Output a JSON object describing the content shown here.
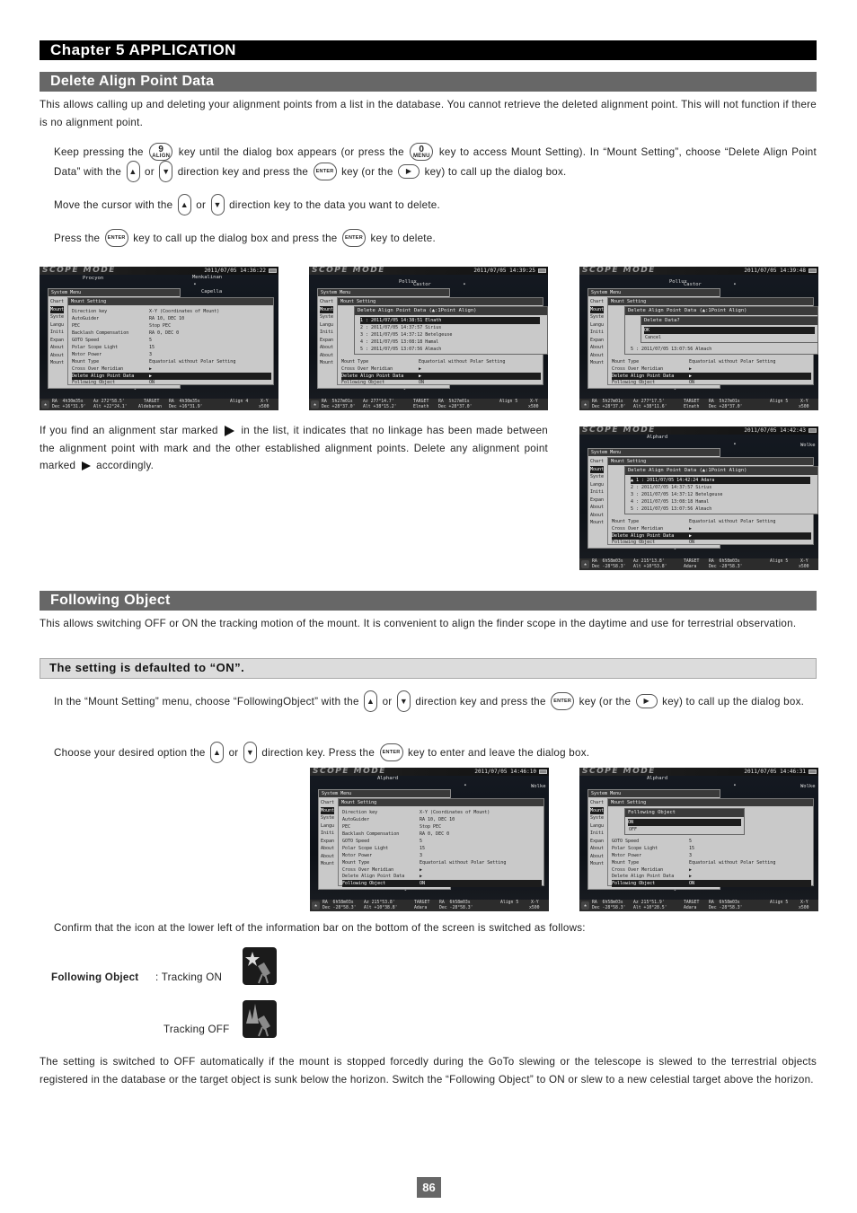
{
  "chapter": "Chapter 5  APPLICATION",
  "sections": {
    "delete_align": {
      "title": "Delete Align Point Data",
      "intro": "This allows calling up and deleting your alignment points from a list in the database.  You cannot retrieve the deleted alignment point. This will not function if there is no alignment point.",
      "step1": {
        "t1": "Keep pressing the",
        "t2": "key until the dialog box appears (or press the",
        "t3": "key to access Mount Setting).  In “Mount Setting”, choose “Delete Align Point Data” with the",
        "t4": "or",
        "t5": "direction key and press the",
        "t6": "key (or the",
        "t7": "key) to call up the dialog box."
      },
      "step2": {
        "t1": "Move the cursor with the",
        "t2": "or",
        "t3": "direction key to the data you want to delete."
      },
      "step3": {
        "t1": "Press the",
        "t2": "key to call up the dialog box and press the",
        "t3": "key to delete."
      },
      "note": {
        "t1": "If you find an alignment star marked",
        "t2": "in the list, it indicates that no linkage has been made between the alignment point with mark and the other established alignment points.  Delete any alignment point marked",
        "t3": "accordingly."
      }
    },
    "following_object": {
      "title": "Following Object",
      "intro": "This allows switching OFF or ON the tracking motion of the mount.  It is convenient to align the finder scope in the daytime and use for terrestrial observation.",
      "default_note": "The setting is defaulted to “ON”.",
      "step1": {
        "t1": "In the “Mount Setting” menu, choose “FollowingObject” with the",
        "t2": "or",
        "t3": "direction key and press the",
        "t4": "key (or the",
        "t5": "key) to call up the dialog box."
      },
      "step2": {
        "t1": "Choose your desired option the",
        "t2": "or",
        "t3": "direction key.  Press the",
        "t4": "key to enter and leave the dialog box."
      },
      "confirm": "Confirm that the icon at the lower left of the information bar on the bottom of the screen is switched as follows:",
      "icon_label": "Following Object",
      "tracking_on": ": Tracking ON",
      "tracking_off": "Tracking OFF",
      "closing": "The setting is switched to OFF automatically if the mount is stopped forcedly during the GoTo slewing or the telescope is slewed to the terrestrial objects registered in the database or the target object is sunk below the horizon.  Switch the “Following Object” to ON or slew to a new celestial target above the horizon."
    }
  },
  "keys": {
    "align_num": "9",
    "align_label": "ALIGN",
    "menu_num": "0",
    "menu_label": "MENU",
    "enter": "ENTER",
    "up": "▲",
    "down": "▼",
    "right": "▶"
  },
  "screen_common": {
    "logo": "SCOPE MODE",
    "system_menu_title": "System Menu",
    "system_menu_items": [
      "Chart",
      "Mount",
      "Syste",
      "Langu",
      "Initi",
      "Expan",
      "About",
      "About",
      "Mount"
    ],
    "mount_setting_title": "Mount Setting",
    "mount_rows": [
      {
        "label": "Direction key",
        "value": "X-Y (Coordinates of Mount)"
      },
      {
        "label": "AutoGuider",
        "value": "RA 10, DEC 10"
      },
      {
        "label": "PEC",
        "value": "Stop PEC"
      },
      {
        "label": "Backlash Compensation",
        "value": "RA 0, DEC 0"
      },
      {
        "label": "GOTO Speed",
        "value": "5"
      },
      {
        "label": "Polar Scope Light",
        "value": "15"
      },
      {
        "label": "Motor Power",
        "value": "3"
      },
      {
        "label": "Mount Type",
        "value": "Equatorial without Polar Setting"
      },
      {
        "label": "Cross Over Meridian",
        "value": "▶"
      },
      {
        "label": "Delete Align Point Data",
        "value": "▶"
      },
      {
        "label": "Following Object",
        "value": "ON"
      }
    ],
    "delete_dialog_title": "Delete Align Point Data (▲:1Point Align)",
    "confirm_dialog_title": "Delete Data?",
    "confirm_options": [
      "OK",
      "Cancel"
    ],
    "following_dialog_title": "Following Object",
    "following_options": [
      "ON",
      "OFF"
    ]
  },
  "screens": [
    {
      "clock": "2011/07/05 14:36:22",
      "stars": [
        "Procyon",
        "Menkalinan",
        "Capella"
      ],
      "info": {
        "ra": "RA  4h30m35s",
        "az": "Az 272°58.5'",
        "dec": "Dec +16°31.9'",
        "alt": "Alt +22°24.1'",
        "target": "TARGET",
        "target_name": "Aldebaran",
        "t_ra": "RA  4h30m35s",
        "t_dec": "Dec +16°31.9'",
        "align": "Align 4",
        "mode": "X-Y",
        "zoom": "x500"
      }
    },
    {
      "clock": "2011/07/05 14:39:25",
      "stars": [
        "Pollux",
        "Castor"
      ],
      "align_points": [
        "1 : 2011/07/05 14:38:51 Elnath",
        "2 : 2011/07/05 14:37:57 Sirius",
        "3 : 2011/07/05 14:37:12 Betelgeuse",
        "4 : 2011/07/05 13:08:18 Hamal",
        "5 : 2011/07/05 13:07:56 Almach"
      ],
      "info": {
        "ra": "RA  5h27m01s",
        "az": "Az 277°14.7'",
        "dec": "Dec +28°37.0'",
        "alt": "Alt +38°15.2'",
        "target": "TARGET",
        "target_name": "Elnath",
        "t_ra": "RA  5h27m01s",
        "t_dec": "Dec +28°37.0'",
        "align": "Align 5",
        "mode": "X-Y",
        "zoom": "x500"
      }
    },
    {
      "clock": "2011/07/05 14:39:48",
      "stars": [
        "Pollux",
        "Castor"
      ],
      "align_points": [
        "5 : 2011/07/05 13:07:56 Almach"
      ],
      "info": {
        "ra": "RA  5h27m01s",
        "az": "Az 277°17.5'",
        "dec": "Dec +28°37.0'",
        "alt": "Alt +38°11.6'",
        "target": "TARGET",
        "target_name": "Elnath",
        "t_ra": "RA  5h27m01s",
        "t_dec": "Dec +28°37.0'",
        "align": "Align 5",
        "mode": "X-Y",
        "zoom": "x500"
      }
    },
    {
      "clock": "2011/07/05 14:42:43",
      "stars": [
        "Alphard",
        "Wolke"
      ],
      "align_points": [
        "▲ 1 : 2011/07/05 14:42:24 Adara",
        "2 : 2011/07/05 14:37:57 Sirius",
        "3 : 2011/07/05 14:37:12 Betelgeuse",
        "4 : 2011/07/05 13:08:18 Hamal",
        "5 : 2011/07/05 13:07:56 Almach"
      ],
      "info": {
        "ra": "RA  6h58m03s",
        "az": "Az 215°13.8'",
        "dec": "Dec -28°58.3'",
        "alt": "Alt +10°53.8'",
        "target": "TARGET",
        "target_name": "Adara",
        "t_ra": "RA  6h58m03s",
        "t_dec": "Dec -28°58.3'",
        "align": "Align 5",
        "mode": "X-Y",
        "zoom": "x500"
      }
    },
    {
      "clock": "2011/07/05 14:46:10",
      "stars": [
        "Alphard",
        "Wolke"
      ],
      "info": {
        "ra": "RA  6h58m03s",
        "az": "Az 215°53.8'",
        "dec": "Dec -28°58.3'",
        "alt": "Alt +10°38.8'",
        "target": "TARGET",
        "target_name": "Adara",
        "t_ra": "RA  6h58m03s",
        "t_dec": "Dec -28°58.3'",
        "align": "Align 5",
        "mode": "X-Y",
        "zoom": "x500"
      }
    },
    {
      "clock": "2011/07/05 14:46:31",
      "stars": [
        "Alphard",
        "Wolke"
      ],
      "info": {
        "ra": "RA  6h58m03s",
        "az": "Az 215°51.9'",
        "dec": "Dec -28°58.3'",
        "alt": "Alt +10°28.5'",
        "target": "TARGET",
        "target_name": "Adara",
        "t_ra": "RA  6h58m03s",
        "t_dec": "Dec -28°58.3'",
        "align": "Align 5",
        "mode": "X-Y",
        "zoom": "x500"
      }
    }
  ],
  "page_number": "86"
}
